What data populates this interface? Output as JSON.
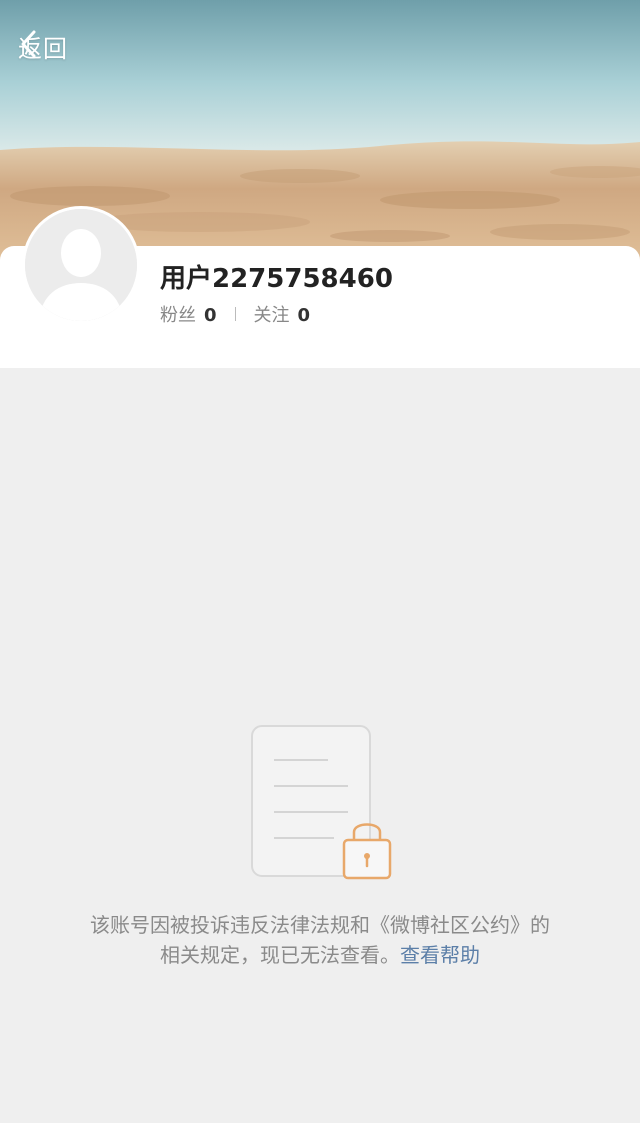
{
  "nav": {
    "back_label": "返回",
    "back_icon": "chevron-left-icon"
  },
  "profile": {
    "avatar_icon": "default-avatar-icon",
    "username": "用户2275758460",
    "fans_label": "粉丝",
    "fans_count": "0",
    "following_label": "关注",
    "following_count": "0"
  },
  "notice": {
    "illustration_icon": "locked-document-icon",
    "line1": "该账号因被投诉违反法律法规和《微博社区公约》的",
    "line2": "相关规定，现已无法查看。",
    "help_link": "查看帮助"
  },
  "colors": {
    "page_bg": "#efefef",
    "card_bg": "#ffffff",
    "link": "#5c7fa8",
    "lock_accent": "#e8a86a",
    "muted_text": "#8a8a8a"
  }
}
